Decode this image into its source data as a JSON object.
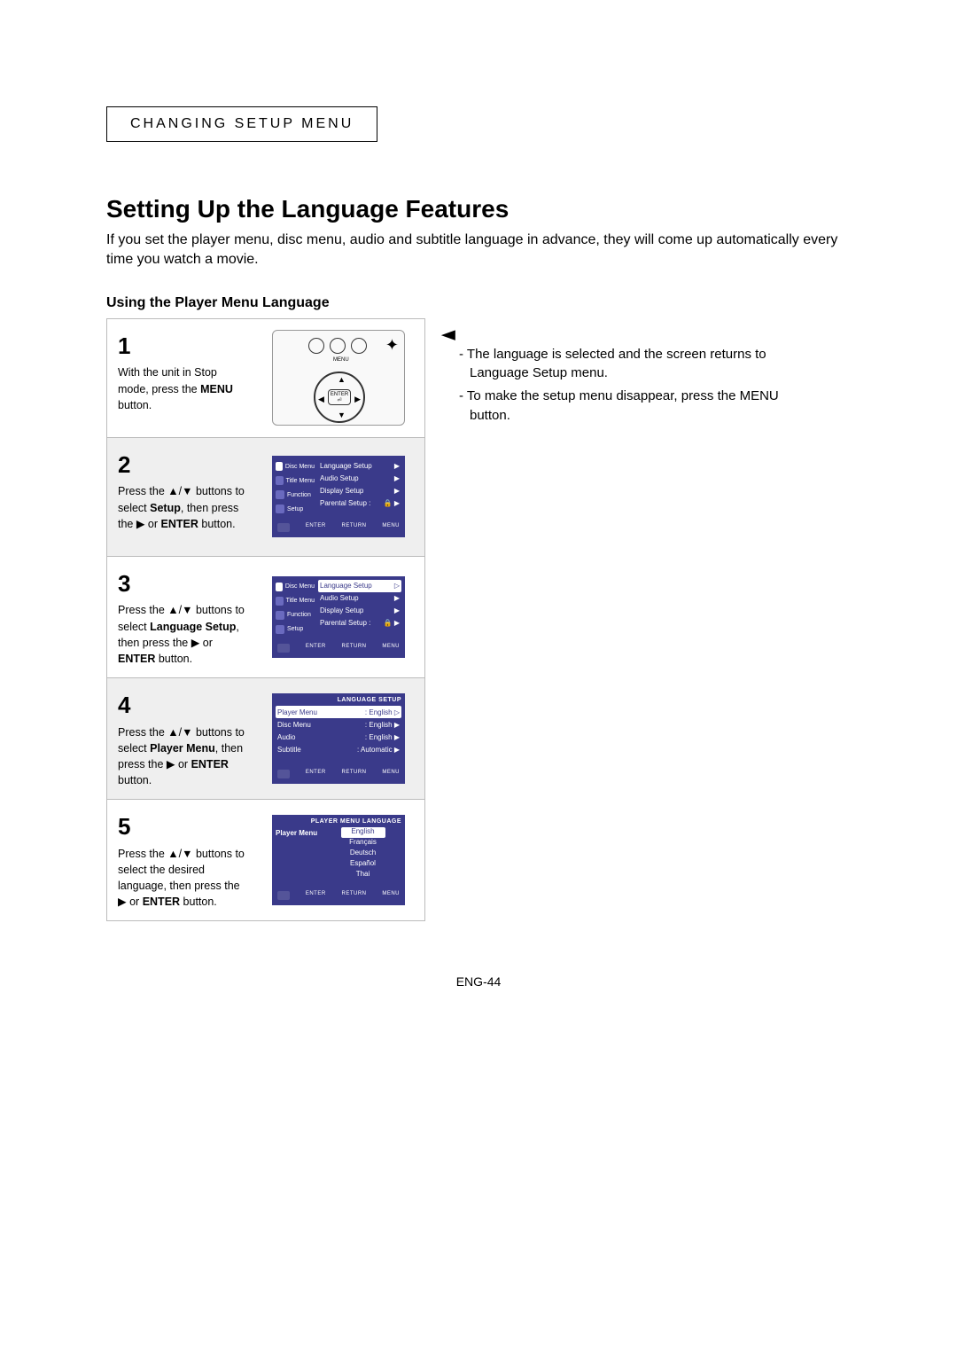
{
  "section_label": "CHANGING SETUP MENU",
  "page_title": "Setting Up the Language Features",
  "intro": "If you set the player menu, disc menu, audio and subtitle language in advance, they will come up automatically every time you watch a movie.",
  "subhead": "Using the Player Menu Language",
  "steps": {
    "s1": {
      "num": "1",
      "text_pre": "With the unit in Stop mode, press the ",
      "bold": "MENU",
      "text_post": " button."
    },
    "s2": {
      "num": "2",
      "text": "Press the ▲/▼ buttons to select <b>Setup</b>, then press the ▶ or <b>ENTER</b> button."
    },
    "s3": {
      "num": "3",
      "text": "Press the ▲/▼ buttons to select <b>Language Setup</b>, then press the ▶ or <b>ENTER</b> button."
    },
    "s4": {
      "num": "4",
      "text": "Press the ▲/▼ buttons to select <b>Player Menu</b>, then press the ▶ or <b>ENTER</b> button."
    },
    "s5": {
      "num": "5",
      "text": "Press the ▲/▼ buttons to select the desired language, then press the ▶ or <b>ENTER</b> button."
    }
  },
  "osd": {
    "side_items": [
      "Disc Menu",
      "Title Menu",
      "Function",
      "Setup"
    ],
    "setup_items": [
      {
        "label": "Language Setup",
        "arrow": "▶"
      },
      {
        "label": "Audio Setup",
        "arrow": "▶"
      },
      {
        "label": "Display Setup",
        "arrow": "▶"
      },
      {
        "label": "Parental Setup :",
        "arrow": "▶",
        "lock": true
      }
    ],
    "lang_setup_title": "LANGUAGE SETUP",
    "lang_setup_items": [
      {
        "label": "Player Menu",
        "value": ": English"
      },
      {
        "label": "Disc Menu",
        "value": ": English"
      },
      {
        "label": "Audio",
        "value": ": English"
      },
      {
        "label": "Subtitle",
        "value": ": Automatic"
      }
    ],
    "player_menu_title": "PLAYER MENU LANGUAGE",
    "player_menu_label": "Player Menu",
    "player_menu_options": [
      "English",
      "Français",
      "Deutsch",
      "Español",
      "Thai"
    ],
    "footer": {
      "enter": "ENTER",
      "return": "RETURN",
      "menu": "MENU"
    }
  },
  "remote": {
    "menu": "MENU",
    "enter": "ENTER"
  },
  "notes": {
    "n1": "The language is selected and the screen returns to Language Setup menu.",
    "n2": "To make the setup menu disappear, press the MENU button."
  },
  "page_number": "ENG-44"
}
